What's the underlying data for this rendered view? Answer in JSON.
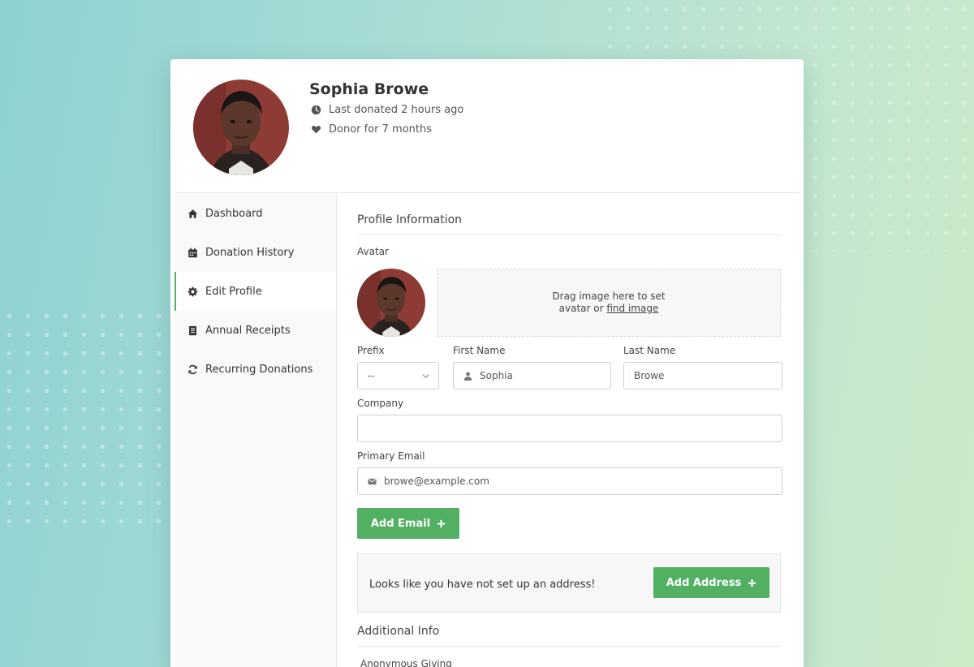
{
  "profile": {
    "name": "Sophia Browe",
    "last_donated": "Last donated 2 hours ago",
    "donor_since": "Donor for 7 months"
  },
  "sidebar": {
    "items": [
      {
        "label": "Dashboard",
        "icon": "home-icon"
      },
      {
        "label": "Donation History",
        "icon": "calendar-icon"
      },
      {
        "label": "Edit Profile",
        "icon": "gear-icon",
        "active": true
      },
      {
        "label": "Annual Receipts",
        "icon": "receipt-icon"
      },
      {
        "label": "Recurring Donations",
        "icon": "refresh-icon"
      }
    ]
  },
  "form": {
    "section_title": "Profile Information",
    "avatar_label": "Avatar",
    "dropzone_line1": "Drag image here to set",
    "dropzone_line2_prefix": "avatar or ",
    "dropzone_link": "find image",
    "prefix_label": "Prefix",
    "prefix_value": "--",
    "first_name_label": "First Name",
    "first_name_value": "Sophia",
    "last_name_label": "Last Name",
    "last_name_value": "Browe",
    "company_label": "Company",
    "company_value": "",
    "email_label": "Primary Email",
    "email_value": "browe@example.com",
    "add_email_button": "Add Email",
    "address_message": "Looks like you have not set up an address!",
    "add_address_button": "Add Address",
    "additional_title": "Additional Info",
    "anonymous_label": "Anonymous Giving"
  },
  "colors": {
    "accent": "#52b062",
    "background_start": "#8fd1d2",
    "background_end": "#cdeac8"
  }
}
